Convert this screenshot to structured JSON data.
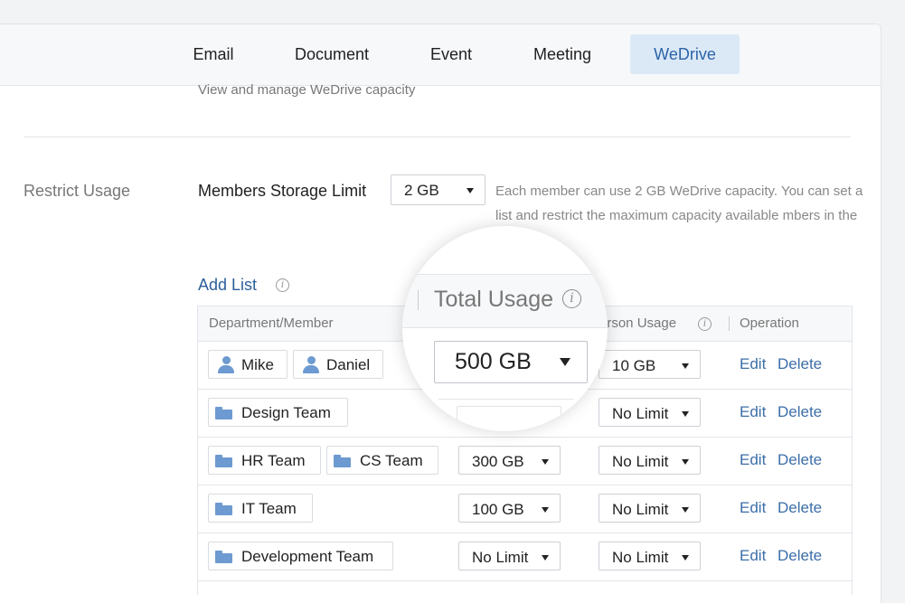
{
  "tabs": [
    {
      "label": "Email",
      "active": false
    },
    {
      "label": "Document",
      "active": false
    },
    {
      "label": "Event",
      "active": false
    },
    {
      "label": "Meeting",
      "active": false
    },
    {
      "label": "WeDrive",
      "active": true
    }
  ],
  "subtitle": "View and manage WeDrive capacity",
  "section_label": "Restrict Usage",
  "members_storage": {
    "label": "Members Storage Limit",
    "value": "2 GB",
    "description": "Each member can use 2 GB WeDrive capacity. You can set a list and restrict the maximum capacity available ",
    "description_tail": "mbers in the list."
  },
  "add_list": {
    "label": "Add List",
    "info_icon": "info-icon"
  },
  "table": {
    "headers": {
      "member": "Department/Member",
      "per_person": "erson Usage",
      "operation": "Operation"
    },
    "rows": [
      {
        "entities": [
          {
            "type": "person",
            "name": "Mike"
          },
          {
            "type": "person",
            "name": "Daniel"
          }
        ],
        "total": "500 GB",
        "per_person": "10 GB",
        "edit": "Edit",
        "delete": "Delete"
      },
      {
        "entities": [
          {
            "type": "folder",
            "name": "Design Team"
          }
        ],
        "total": "",
        "per_person": "No Limit",
        "edit": "Edit",
        "delete": "Delete"
      },
      {
        "entities": [
          {
            "type": "folder",
            "name": "HR Team"
          },
          {
            "type": "folder",
            "name": "CS Team"
          }
        ],
        "total": "300 GB",
        "per_person": "No Limit",
        "edit": "Edit",
        "delete": "Delete"
      },
      {
        "entities": [
          {
            "type": "folder",
            "name": "IT Team"
          }
        ],
        "total": "100 GB",
        "per_person": "No Limit",
        "edit": "Edit",
        "delete": "Delete"
      },
      {
        "entities": [
          {
            "type": "folder",
            "name": "Development Team"
          }
        ],
        "total": "No Limit",
        "per_person": "No Limit",
        "edit": "Edit",
        "delete": "Delete"
      }
    ]
  },
  "magnifier": {
    "header_label": "Total Usage",
    "value": "500 GB"
  },
  "colors": {
    "accent": "#2c63a8",
    "link": "#3c6ea8",
    "icon": "#6d9ad0",
    "active_tab_bg": "#dbe9f7"
  }
}
